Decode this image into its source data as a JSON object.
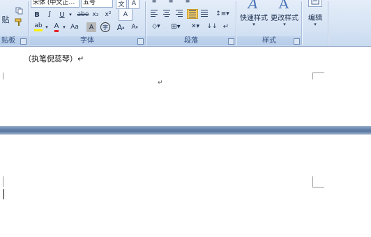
{
  "clipboard": {
    "paste_label": "贴",
    "group_label": "贴板"
  },
  "font": {
    "font_name": "宋体 (中文正…",
    "font_size": "五号",
    "group_label": "字体",
    "bold": "B",
    "italic": "I",
    "underline": "U",
    "strike": "abe",
    "subscript": "x₂",
    "superscript": "x²",
    "highlight": "ab",
    "font_color": "A",
    "change_case": "Aa",
    "char_shading": "A",
    "enclose": "字",
    "grow": "A",
    "shrink": "A",
    "clear_format": "A"
  },
  "paragraph": {
    "group_label": "段落"
  },
  "styles": {
    "quick_styles_label": "快速样式",
    "change_styles_label": "更改样式",
    "group_label": "样式"
  },
  "editing": {
    "label": "编辑"
  },
  "document": {
    "page1_line": "（执笔倪蕊琴）↵",
    "paragraph_mark": "↵"
  }
}
